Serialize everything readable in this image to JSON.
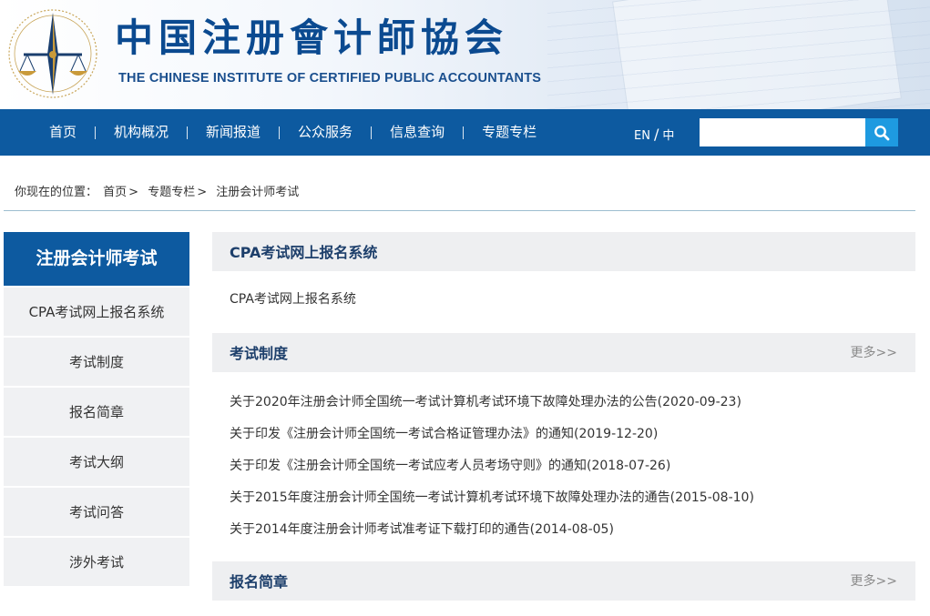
{
  "header": {
    "title_cn": "中国注册會计師協会",
    "title_en": "THE CHINESE INSTITUTE OF CERTIFIED PUBLIC ACCOUNTANTS",
    "logo_icon": "scales-of-justice-emblem-icon"
  },
  "nav": {
    "items": [
      {
        "label": "首页"
      },
      {
        "label": "机构概况"
      },
      {
        "label": "新闻报道"
      },
      {
        "label": "公众服务"
      },
      {
        "label": "信息查询"
      },
      {
        "label": "专题专栏"
      }
    ],
    "lang_en": "EN",
    "lang_slash": "/",
    "lang_zh": "中",
    "search_placeholder": "",
    "search_icon": "search-icon"
  },
  "breadcrumb": {
    "label": "你现在的位置：",
    "items": [
      "首页",
      "专题专栏",
      "注册会计师考试"
    ],
    "separator": ">"
  },
  "sidebar": {
    "title": "注册会计师考试",
    "items": [
      {
        "label": "CPA考试网上报名系统"
      },
      {
        "label": "考试制度"
      },
      {
        "label": "报名简章"
      },
      {
        "label": "考试大纲"
      },
      {
        "label": "考试问答"
      },
      {
        "label": "涉外考试"
      }
    ]
  },
  "main": {
    "sections": [
      {
        "title": "CPA考试网上报名系统",
        "more": "",
        "items": [
          "CPA考试网上报名系统"
        ]
      },
      {
        "title": "考试制度",
        "more": "更多>>",
        "items": [
          "关于2020年注册会计师全国统一考试计算机考试环境下故障处理办法的公告(2020-09-23)",
          "关于印发《注册会计师全国统一考试合格证管理办法》的通知(2019-12-20)",
          "关于印发《注册会计师全国统一考试应考人员考场守则》的通知(2018-07-26)",
          "关于2015年度注册会计师全国统一考试计算机考试环境下故障处理办法的通告(2015-08-10)",
          "关于2014年度注册会计师考试准考证下载打印的通告(2014-08-05)"
        ]
      },
      {
        "title": "报名简章",
        "more": "更多>>",
        "items": []
      }
    ]
  },
  "colors": {
    "brand_blue": "#0d5aa0",
    "search_button": "#1e9ae0",
    "section_bg": "#eeeff1",
    "section_title": "#1d3f6b"
  }
}
